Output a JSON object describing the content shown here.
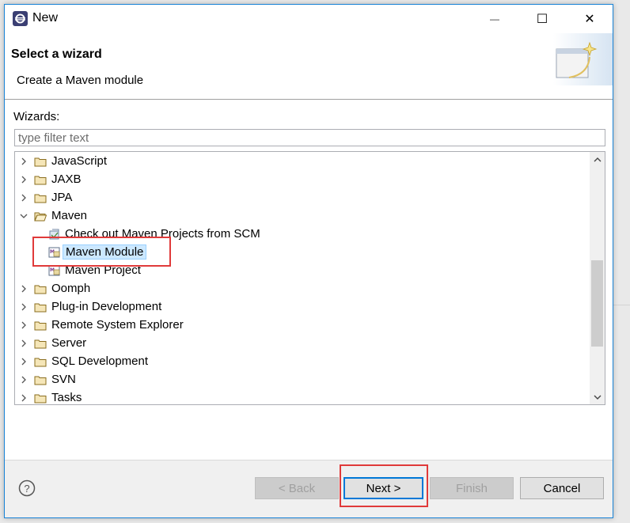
{
  "window": {
    "title": "New",
    "minimize_glyph": "—",
    "maximize_glyph": "☐",
    "close_glyph": "✕"
  },
  "header": {
    "title": "Select a wizard",
    "subtitle": "Create a Maven module"
  },
  "wizards": {
    "label": "Wizards:",
    "filter_placeholder": "type filter text",
    "filter_value": ""
  },
  "tree": {
    "items": [
      {
        "label": "JavaScript",
        "level": 0,
        "expanded": false,
        "icon": "folder-icon"
      },
      {
        "label": "JAXB",
        "level": 0,
        "expanded": false,
        "icon": "folder-icon"
      },
      {
        "label": "JPA",
        "level": 0,
        "expanded": false,
        "icon": "folder-icon"
      },
      {
        "label": "Maven",
        "level": 0,
        "expanded": true,
        "icon": "folder-open-icon"
      },
      {
        "label": "Check out Maven Projects from SCM",
        "level": 1,
        "icon": "checkout-icon"
      },
      {
        "label": "Maven Module",
        "level": 1,
        "icon": "maven-icon",
        "selected": true
      },
      {
        "label": "Maven Project",
        "level": 1,
        "icon": "maven-icon"
      },
      {
        "label": "Oomph",
        "level": 0,
        "expanded": false,
        "icon": "folder-icon"
      },
      {
        "label": "Plug-in Development",
        "level": 0,
        "expanded": false,
        "icon": "folder-icon"
      },
      {
        "label": "Remote System Explorer",
        "level": 0,
        "expanded": false,
        "icon": "folder-icon"
      },
      {
        "label": "Server",
        "level": 0,
        "expanded": false,
        "icon": "folder-icon"
      },
      {
        "label": "SQL Development",
        "level": 0,
        "expanded": false,
        "icon": "folder-icon"
      },
      {
        "label": "SVN",
        "level": 0,
        "expanded": false,
        "icon": "folder-icon"
      },
      {
        "label": "Tasks",
        "level": 0,
        "expanded": false,
        "icon": "folder-icon"
      }
    ]
  },
  "footer": {
    "help_glyph": "?",
    "back_label": "< Back",
    "next_label": "Next >",
    "finish_label": "Finish",
    "cancel_label": "Cancel"
  },
  "colors": {
    "accent": "#0078d7",
    "highlight_box": "#e03a3a",
    "selection": "#cce8ff"
  }
}
